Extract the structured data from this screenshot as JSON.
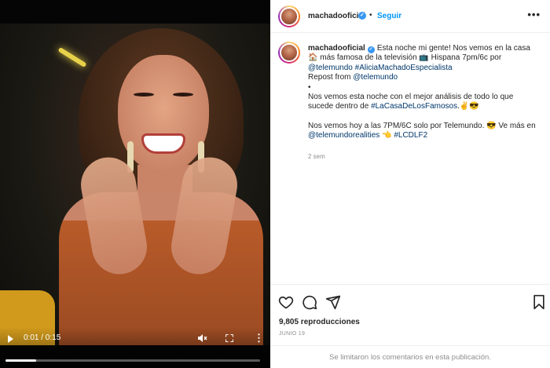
{
  "video": {
    "time": "0:01 / 0:15",
    "progress": 0.12
  },
  "post": {
    "username": "machadooficial",
    "follow_label": "Seguir",
    "more_label": "•••",
    "caption": {
      "line1_text": "Esta noche mi gente! Nos vemos en la casa",
      "line2_text": "más famosa de la televisión",
      "line2_after": "Hispana 7pm/6c por",
      "mention_telemundo": "@telemundo",
      "hashtag_especialista": "#AliciaMachadoEspecialista",
      "repost_text": "Repost from",
      "repost_mention": "@telemundo",
      "bullet": "•",
      "para2_line1": "Nos vemos esta noche con el mejor análisis de todo lo que",
      "para2_line2_before": "sucede dentro de",
      "hashtag_casa": "#LaCasaDeLosFamosos",
      "para2_emojis": ".✌😎",
      "para3_line1": "Nos vemos hoy a las 7PM/6C solo por Telemundo. 😎 Ve más en",
      "mention_realities": "@telemundorealities",
      "point_emoji": "👈",
      "hashtag_lcdlf2": "#LCDLF2",
      "house_emoji": "🏠",
      "tv_emoji": "📺",
      "heart_emoji": "♥"
    },
    "time_ago": "2 sem",
    "views": "9,805 reproducciones",
    "date": "JUNIO 19",
    "comments_limited": "Se limitaron los comentarios en esta publicación."
  },
  "colors": {
    "link": "#00376b",
    "follow": "#0095f6",
    "verified": "#3897f0",
    "muted": "#8e8e8e"
  },
  "icons": [
    "play-icon",
    "mute-icon",
    "fullscreen-icon",
    "more-vertical-icon",
    "verified-icon",
    "more-horizontal-icon",
    "heart-icon",
    "comment-icon",
    "share-icon",
    "bookmark-icon"
  ]
}
